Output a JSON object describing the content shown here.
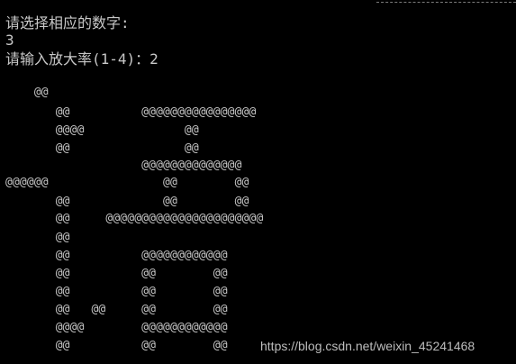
{
  "console": {
    "lines": [
      "请选择相应的数字:",
      "3",
      "请输入放大率(1-4)：2"
    ],
    "art_lines": [
      "    @@",
      "       @@          @@@@@@@@@@@@@@@@",
      "       @@@@              @@",
      "       @@                @@",
      "                   @@@@@@@@@@@@@@",
      "@@@@@@                @@        @@",
      "       @@             @@        @@",
      "       @@     @@@@@@@@@@@@@@@@@@@@@@",
      "       @@",
      "       @@          @@@@@@@@@@@@",
      "       @@          @@        @@",
      "       @@          @@        @@",
      "       @@   @@     @@        @@",
      "       @@@@        @@@@@@@@@@@@",
      "       @@          @@        @@"
    ]
  },
  "watermark": {
    "text": "https://blog.csdn.net/weixin_45241468"
  }
}
